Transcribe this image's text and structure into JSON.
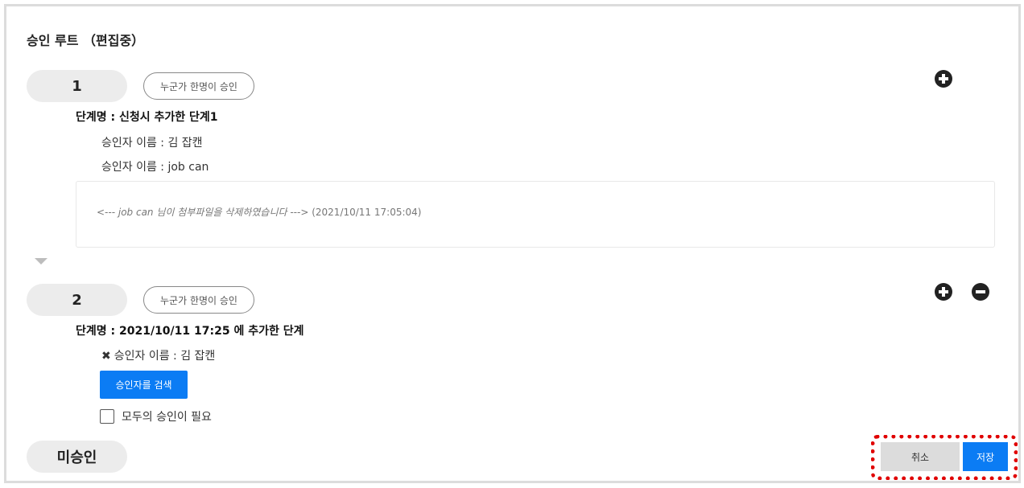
{
  "page": {
    "title": "승인 루트 （편집중）"
  },
  "stages": [
    {
      "number": "1",
      "mode_label": "누군가 한명이 승인",
      "stage_name": "단계명 : 신청시 추가한 단계1",
      "approvers": [
        "승인자 이름 : 김 잡캔",
        "승인자 이름 : job can"
      ],
      "comment": {
        "message": "<--- job can 님이 첨부파일을 삭제하였습니다 --->",
        "timestamp": "(2021/10/11 17:05:04)"
      }
    },
    {
      "number": "2",
      "mode_label": "누군가 한명이 승인",
      "stage_name": "단계명 : 2021/10/11 17:25 에 추가한 단계",
      "approvers": [
        "승인자 이름 : 김 잡캔"
      ],
      "remove_mark": "✖",
      "search_button": "승인자를 검색",
      "require_all_label": "모두의 승인이 필요"
    }
  ],
  "status": {
    "label": "미승인"
  },
  "actions": {
    "cancel_label": "취소",
    "save_label": "저장"
  },
  "icons": {
    "add": "plus-circle-icon",
    "remove": "minus-circle-icon",
    "arrow": "triangle-down-icon"
  },
  "colors": {
    "primary": "#0b7cf4",
    "highlight": "#e00000",
    "pill_bg": "#ececec"
  }
}
